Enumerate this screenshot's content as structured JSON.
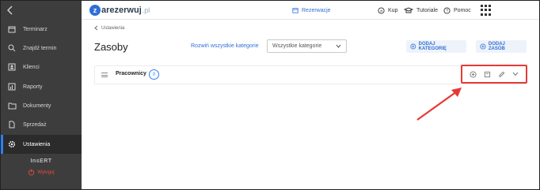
{
  "sidebar": {
    "items": [
      {
        "label": "Terminarz",
        "icon": "calendar-icon"
      },
      {
        "label": "Znajdź termin",
        "icon": "search-icon"
      },
      {
        "label": "Klienci",
        "icon": "client-card-icon"
      },
      {
        "label": "Raporty",
        "icon": "report-icon"
      },
      {
        "label": "Dokumenty",
        "icon": "folder-icon"
      },
      {
        "label": "Sprzedaż",
        "icon": "sales-doc-icon"
      },
      {
        "label": "Ustawienia",
        "icon": "gear-icon",
        "active": true
      }
    ],
    "brand": "InsERT",
    "logout_label": "Wyloguj"
  },
  "topbar": {
    "logo_text": "arezerwuj",
    "logo_tld": ".pl",
    "reservations_label": "Rezerwacje",
    "buy_label": "Kup",
    "tutorials_label": "Tutoriale",
    "help_label": "Pomoc"
  },
  "main": {
    "breadcrumb": "Ustawienia",
    "title": "Zasoby",
    "expand_all_label": "Rozwiń wszystkie kategorie",
    "category_select": {
      "value": "Wszystkie kategorie"
    },
    "add_category_label": "DODAJ KATEGORIĘ",
    "add_resource_label": "DODAJ ZASÓB",
    "categories": [
      {
        "name": "Pracownicy",
        "count": "0"
      }
    ]
  },
  "colors": {
    "accent": "#2f6fd6",
    "sidebar_bg": "#3d3d3d",
    "highlight": "#e53935"
  }
}
